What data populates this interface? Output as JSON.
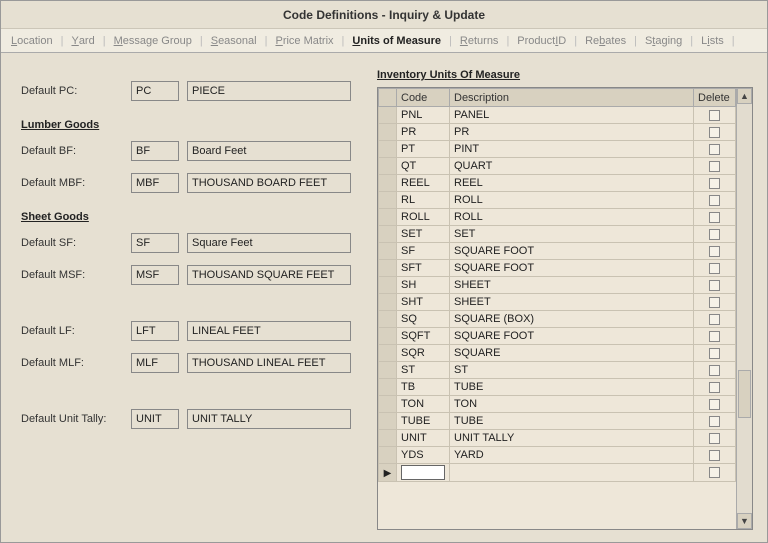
{
  "title": "Code Definitions - Inquiry & Update",
  "tabs": [
    {
      "pre": "",
      "u": "L",
      "post": "ocation",
      "active": false
    },
    {
      "pre": "",
      "u": "Y",
      "post": "ard",
      "active": false
    },
    {
      "pre": "",
      "u": "M",
      "post": "essage Group",
      "active": false
    },
    {
      "pre": "",
      "u": "S",
      "post": "easonal",
      "active": false
    },
    {
      "pre": "",
      "u": "P",
      "post": "rice Matrix",
      "active": false
    },
    {
      "pre": "",
      "u": "U",
      "post": "nits of Measure",
      "active": true
    },
    {
      "pre": "",
      "u": "R",
      "post": "eturns",
      "active": false
    },
    {
      "pre": "Product ",
      "u": "I",
      "post": "D",
      "active": false
    },
    {
      "pre": "Re",
      "u": "b",
      "post": "ates",
      "active": false
    },
    {
      "pre": "S",
      "u": "t",
      "post": "aging",
      "active": false
    },
    {
      "pre": "L",
      "u": "i",
      "post": "sts",
      "active": false
    }
  ],
  "left": {
    "default_pc": {
      "label": "Default PC:",
      "code": "PC",
      "desc": "PIECE"
    },
    "lumber_header": "Lumber Goods",
    "default_bf": {
      "label": "Default BF:",
      "code": "BF",
      "desc": "Board Feet"
    },
    "default_mbf": {
      "label": "Default MBF:",
      "code": "MBF",
      "desc": "THOUSAND BOARD FEET"
    },
    "sheet_header": "Sheet Goods",
    "default_sf": {
      "label": "Default SF:",
      "code": "SF",
      "desc": "Square Feet"
    },
    "default_msf": {
      "label": "Default MSF:",
      "code": "MSF",
      "desc": "THOUSAND SQUARE FEET"
    },
    "default_lf": {
      "label": "Default LF:",
      "code": "LFT",
      "desc": "LINEAL FEET"
    },
    "default_mlf": {
      "label": "Default MLF:",
      "code": "MLF",
      "desc": "THOUSAND LINEAL FEET"
    },
    "default_tally": {
      "label": "Default Unit Tally:",
      "code": "UNIT",
      "desc": "UNIT TALLY"
    }
  },
  "grid": {
    "title": "Inventory Units Of Measure",
    "headers": {
      "code": "Code",
      "desc": "Description",
      "delete": "Delete"
    },
    "rows": [
      {
        "code": "PNL",
        "desc": "PANEL"
      },
      {
        "code": "PR",
        "desc": "PR"
      },
      {
        "code": "PT",
        "desc": "PINT"
      },
      {
        "code": "QT",
        "desc": "QUART"
      },
      {
        "code": "REEL",
        "desc": "REEL"
      },
      {
        "code": "RL",
        "desc": "ROLL"
      },
      {
        "code": "ROLL",
        "desc": "ROLL"
      },
      {
        "code": "SET",
        "desc": "SET"
      },
      {
        "code": "SF",
        "desc": "SQUARE FOOT"
      },
      {
        "code": "SFT",
        "desc": "SQUARE FOOT"
      },
      {
        "code": "SH",
        "desc": "SHEET"
      },
      {
        "code": "SHT",
        "desc": "SHEET"
      },
      {
        "code": "SQ",
        "desc": "SQUARE (BOX)"
      },
      {
        "code": "SQFT",
        "desc": "SQUARE FOOT"
      },
      {
        "code": "SQR",
        "desc": "SQUARE"
      },
      {
        "code": "ST",
        "desc": "ST"
      },
      {
        "code": "TB",
        "desc": "TUBE"
      },
      {
        "code": "TON",
        "desc": "TON"
      },
      {
        "code": "TUBE",
        "desc": "TUBE"
      },
      {
        "code": "UNIT",
        "desc": "UNIT TALLY"
      },
      {
        "code": "YDS",
        "desc": "YARD"
      }
    ]
  }
}
